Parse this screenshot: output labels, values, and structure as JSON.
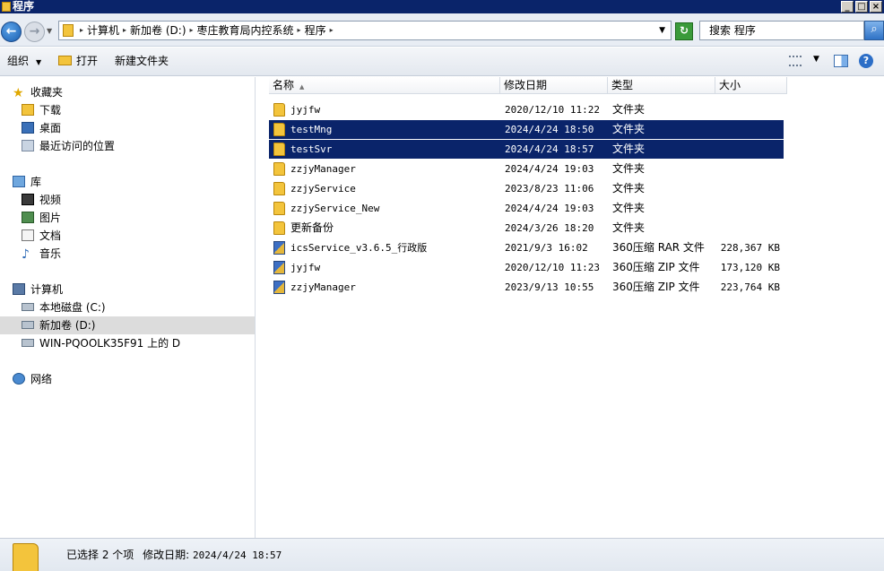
{
  "window": {
    "title": "程序"
  },
  "address": {
    "crumbs": [
      "计算机",
      "新加卷 (D:)",
      "枣庄教育局内控系统",
      "程序"
    ],
    "search_placeholder": "搜索 程序"
  },
  "toolbar": {
    "organize": "组织",
    "open": "打开",
    "new_folder": "新建文件夹"
  },
  "nav": {
    "favorites": "收藏夹",
    "downloads": "下载",
    "desktop": "桌面",
    "recent": "最近访问的位置",
    "libraries": "库",
    "videos": "视频",
    "pictures": "图片",
    "documents": "文档",
    "music": "音乐",
    "computer": "计算机",
    "drive_c": "本地磁盘 (C:)",
    "drive_d": "新加卷 (D:)",
    "network_drive": "WIN-PQOOLK35F91 上的 D",
    "network": "网络"
  },
  "columns": {
    "name": "名称",
    "date": "修改日期",
    "type": "类型",
    "size": "大小"
  },
  "files": [
    {
      "name": "jyjfw",
      "date": "2020/12/10 11:22",
      "type": "文件夹",
      "size": ""
    },
    {
      "name": "testMng",
      "date": "2024/4/24 18:50",
      "type": "文件夹",
      "size": ""
    },
    {
      "name": "testSvr",
      "date": "2024/4/24 18:57",
      "type": "文件夹",
      "size": ""
    },
    {
      "name": "zzjyManager",
      "date": "2024/4/24 19:03",
      "type": "文件夹",
      "size": ""
    },
    {
      "name": "zzjyService",
      "date": "2023/8/23 11:06",
      "type": "文件夹",
      "size": ""
    },
    {
      "name": "zzjyService_New",
      "date": "2024/4/24 19:03",
      "type": "文件夹",
      "size": ""
    },
    {
      "name": "更新备份",
      "date": "2024/3/26 18:20",
      "type": "文件夹",
      "size": ""
    },
    {
      "name": "icsService_v3.6.5_行政版",
      "date": "2021/9/3 16:02",
      "type": "360压缩 RAR 文件",
      "size": "228,367 KB"
    },
    {
      "name": "jyjfw",
      "date": "2020/12/10 11:23",
      "type": "360压缩 ZIP 文件",
      "size": "173,120 KB"
    },
    {
      "name": "zzjyManager",
      "date": "2023/9/13 10:55",
      "type": "360压缩 ZIP 文件",
      "size": "223,764 KB"
    }
  ],
  "status": {
    "selected": "已选择 2 个项",
    "date_label": "修改日期:",
    "date_value": "2024/4/24 18:57"
  }
}
